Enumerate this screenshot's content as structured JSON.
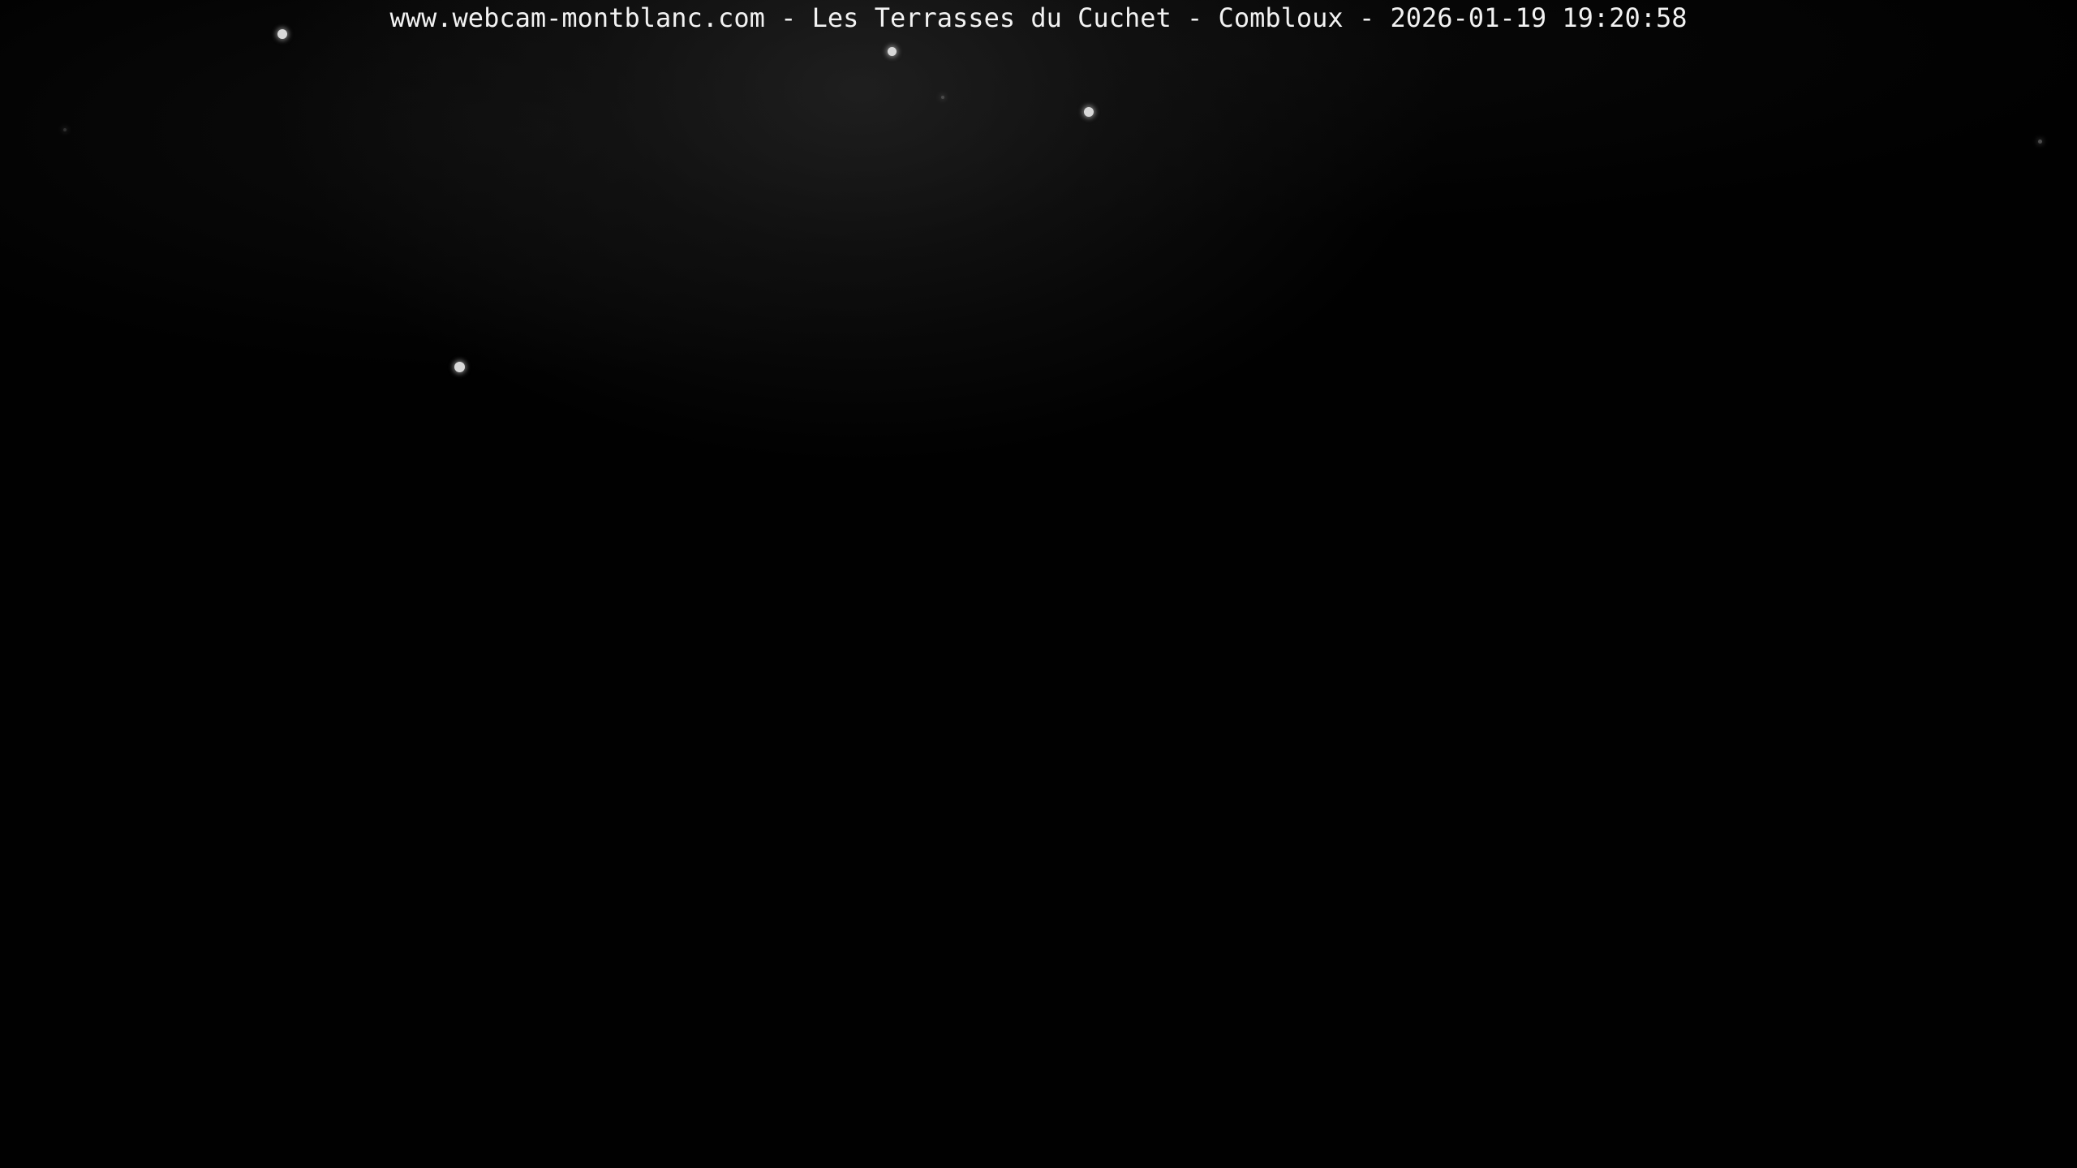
{
  "overlay": {
    "caption": "www.webcam-montblanc.com - Les Terrasses du Cuchet - Combloux - 2026-01-19 19:20:58"
  },
  "scene": {
    "background_color": "#010101",
    "text_color": "#f2f2f2",
    "star_color": "#d8d8d8"
  }
}
